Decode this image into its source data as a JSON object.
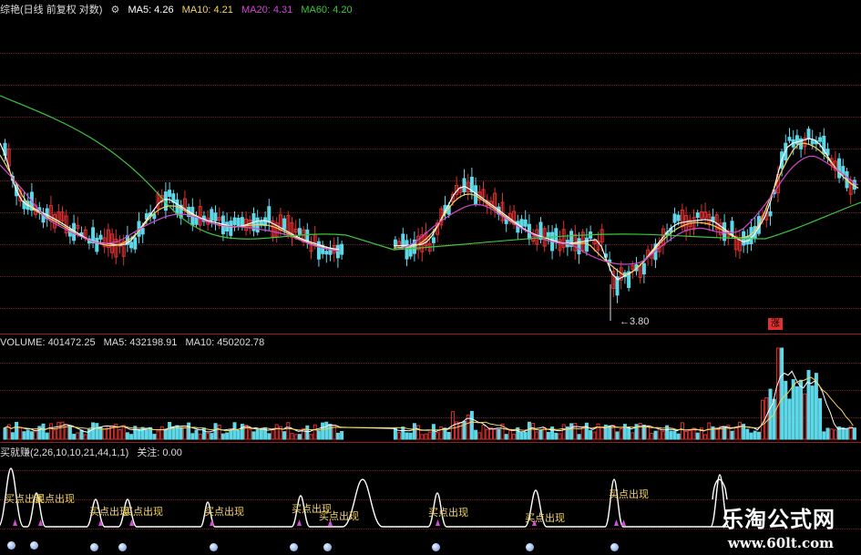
{
  "price_panel": {
    "title": "综艳(日线 前复权 对数)",
    "ma_labels": [
      {
        "text": "MA5: 4.26",
        "color": "#ffffff"
      },
      {
        "text": "MA10: 4.21",
        "color": "#f4d35e"
      },
      {
        "text": "MA20: 4.31",
        "color": "#d048d0"
      },
      {
        "text": "MA60: 4.20",
        "color": "#3cc83c"
      }
    ],
    "low_label": "3.80",
    "rise_badge": "涨"
  },
  "volume_panel": {
    "labels": [
      {
        "text": "VOLUME: 401472.25",
        "color": "#dddddd"
      },
      {
        "text": "MA5: 432198.91",
        "color": "#dddddd"
      },
      {
        "text": "MA10: 450202.78",
        "color": "#dddddd"
      }
    ]
  },
  "indicator_panel": {
    "title": "买就赚(2,26,10,10,21,44,1,1)",
    "watch": "关注: 0.00",
    "buy_signal_text": "买点出现",
    "buy_labels": [
      "买点出现",
      "买点出现",
      "买点出现",
      "买点出现",
      "买点出现",
      "买点出现",
      "买点出现",
      "买点出现",
      "买点出现",
      "买点出现"
    ]
  },
  "watermark": {
    "title": "乐淘公式网",
    "url": "www.60lt.com"
  },
  "colors": {
    "up": "#e03030",
    "down": "#5ed8e8",
    "grid": "#7a1d1d",
    "ma5": "#ffffff",
    "ma10": "#f4d35e",
    "ma20": "#d048d0",
    "ma60": "#3cc83c"
  }
}
